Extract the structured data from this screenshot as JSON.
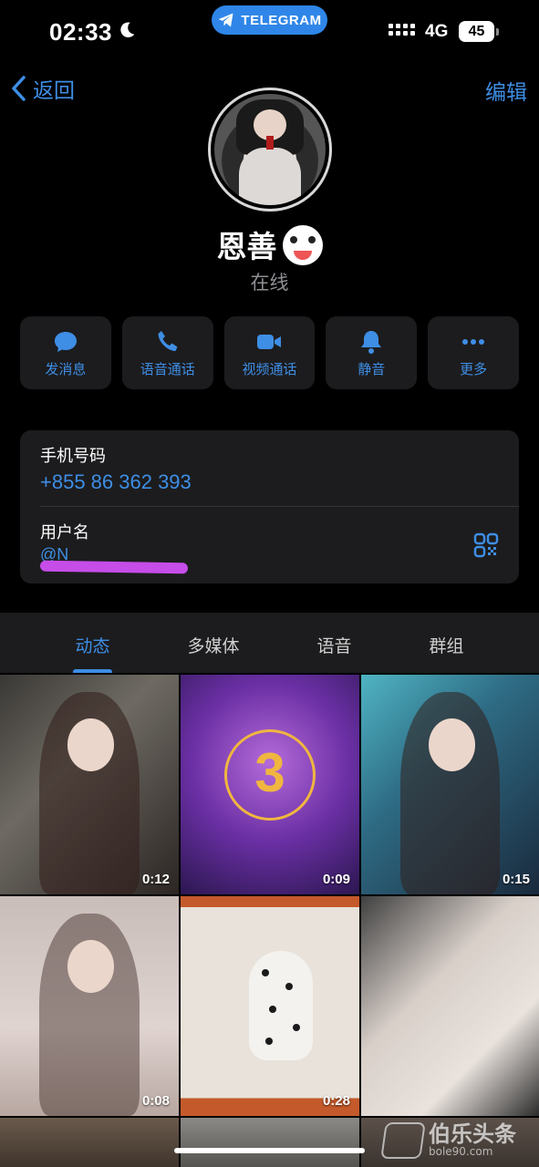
{
  "status_bar": {
    "time": "02:33",
    "pill_label": "TELEGRAM",
    "network": "4G",
    "battery": "45"
  },
  "nav": {
    "back_label": "返回",
    "edit_label": "编辑"
  },
  "profile": {
    "name": "恩善",
    "status": "在线"
  },
  "actions": [
    {
      "label": "发消息",
      "icon": "chat-bubble-icon"
    },
    {
      "label": "语音通话",
      "icon": "phone-icon"
    },
    {
      "label": "视频通话",
      "icon": "video-camera-icon"
    },
    {
      "label": "静音",
      "icon": "bell-icon"
    },
    {
      "label": "更多",
      "icon": "more-dots-icon"
    }
  ],
  "info": {
    "phone_label": "手机号码",
    "phone_value": "+855 86 362 393",
    "username_label": "用户名",
    "username_value": "@N"
  },
  "tabs": [
    {
      "label": "动态",
      "active": true
    },
    {
      "label": "多媒体",
      "active": false
    },
    {
      "label": "语音",
      "active": false
    },
    {
      "label": "群组",
      "active": false
    }
  ],
  "media": [
    {
      "duration": "0:12"
    },
    {
      "duration": "0:09"
    },
    {
      "duration": "0:15"
    },
    {
      "duration": "0:08"
    },
    {
      "duration": "0:28"
    },
    {
      "duration": ""
    }
  ],
  "watermark": {
    "text": "伯乐头条",
    "url": "bole90.com"
  },
  "colors": {
    "accent": "#3e8ee5",
    "card": "#1c1c1e",
    "background": "#000000"
  }
}
